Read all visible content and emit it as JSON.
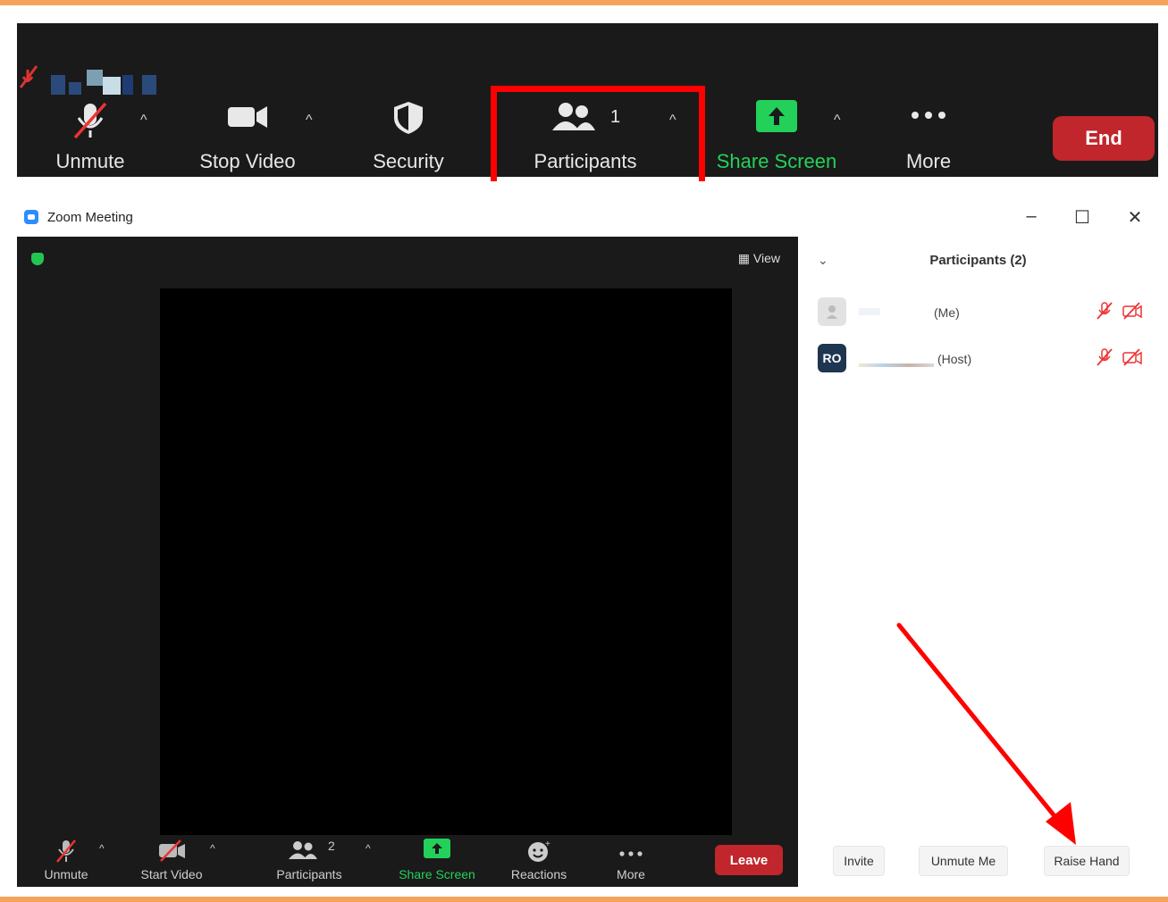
{
  "colors": {
    "frame_orange": "#f5a25a",
    "toolbar_bg": "#1a1a1a",
    "end_red": "#c0262b",
    "share_green": "#23d15a",
    "highlight_red": "#ff0000"
  },
  "top_toolbar": {
    "unmute_label": "Unmute",
    "stop_video_label": "Stop Video",
    "security_label": "Security",
    "participants_label": "Participants",
    "participants_count": "1",
    "share_screen_label": "Share Screen",
    "more_label": "More",
    "end_label": "End"
  },
  "window": {
    "title": "Zoom Meeting",
    "view_label": "View"
  },
  "bottom_toolbar": {
    "unmute_label": "Unmute",
    "start_video_label": "Start Video",
    "participants_label": "Participants",
    "participants_count": "2",
    "share_screen_label": "Share Screen",
    "reactions_label": "Reactions",
    "more_label": "More",
    "leave_label": "Leave"
  },
  "participants_panel": {
    "title": "Participants (2)",
    "participants": [
      {
        "tag": "(Me)",
        "avatar": "",
        "muted": true,
        "video_off": true
      },
      {
        "tag": "(Host)",
        "avatar": "RO",
        "muted": true,
        "video_off": true
      }
    ],
    "invite_label": "Invite",
    "unmute_me_label": "Unmute Me",
    "raise_hand_label": "Raise Hand"
  }
}
